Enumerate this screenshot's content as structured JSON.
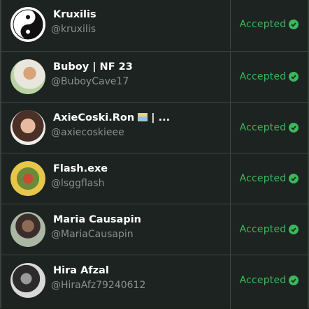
{
  "rows": [
    {
      "name": "Kruxilis",
      "handle": "@kruxilis",
      "status": "Accepted"
    },
    {
      "name": "Buboy | NF 23",
      "handle": "@BuboyCave17",
      "status": "Accepted"
    },
    {
      "name": "AxieCoski.Ron",
      "name_suffix": "| ...",
      "handle": "@axiecoskieee",
      "status": "Accepted"
    },
    {
      "name": "Flash.exe",
      "handle": "@lsggflash",
      "status": "Accepted"
    },
    {
      "name": "Maria Causapin",
      "handle": "@MariaCausapin",
      "status": "Accepted"
    },
    {
      "name": "Hira Afzal",
      "handle": "@HiraAfz79240612",
      "status": "Accepted"
    }
  ],
  "colors": {
    "accepted": "#3cb85c",
    "background": "#1d2320",
    "handle": "#8c918e"
  },
  "icons": {
    "status": "check-circle-icon"
  }
}
